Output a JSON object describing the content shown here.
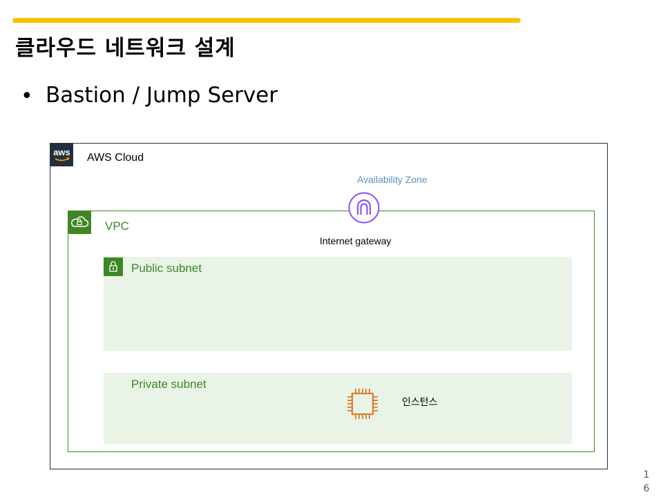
{
  "slide": {
    "title": "클라우드 네트워크 설계",
    "bullet_symbol": "•",
    "bullet_text": "Bastion / Jump Server",
    "page_number": "1\n6",
    "accent_color": "#f5c400"
  },
  "diagram": {
    "aws_cloud": {
      "label": "AWS Cloud",
      "logo_text": "aws",
      "border_color": "#232f3e"
    },
    "availability_zone": {
      "label": "Availability Zone",
      "color": "#5a8fc0"
    },
    "vpc": {
      "label": "VPC",
      "icon": "vpc-cloud-lock-icon",
      "color": "#3f8624"
    },
    "internet_gateway": {
      "label": "Internet gateway",
      "icon": "internet-gateway-icon",
      "color": "#8c4fff"
    },
    "public_subnet": {
      "label": "Public subnet",
      "icon": "lock-icon",
      "fill": "#e9f4e6"
    },
    "private_subnet": {
      "label": "Private subnet",
      "fill": "#e9f4e6"
    },
    "instance": {
      "label": "인스턴스",
      "icon": "ec2-instance-icon",
      "color": "#e07b2a"
    }
  }
}
